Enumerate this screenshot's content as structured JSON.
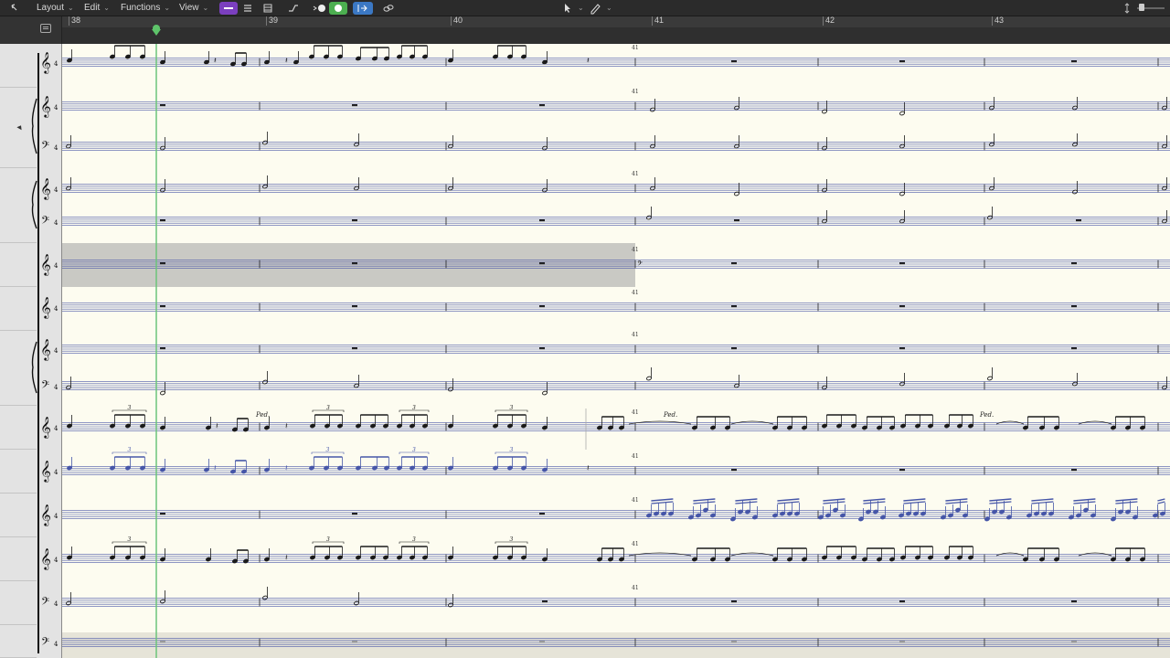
{
  "toolbar": {
    "back_icon": "back-arrow-icon",
    "menus": [
      {
        "label": "Layout"
      },
      {
        "label": "Edit"
      },
      {
        "label": "Functions"
      },
      {
        "label": "View"
      }
    ],
    "view_modes": [
      "linear-view-icon",
      "page-view-icon",
      "score-set-icon"
    ],
    "tools": [
      "catch-icon",
      "midi-in-icon",
      "midi-out-icon",
      "link-icon"
    ],
    "pointer_tool": "pointer-icon",
    "pencil_tool": "pencil-icon",
    "accent_purple": "#7b3fbf",
    "accent_green": "#4caf50",
    "accent_blue": "#3b78c4"
  },
  "ruler": {
    "bars": [
      "38",
      "39",
      "40",
      "41",
      "42",
      "43"
    ],
    "playhead_color": "#5ec46a"
  },
  "score": {
    "measure_label": "41",
    "pedal_label": "Ped.",
    "tuplet_label": "3",
    "note_black": "#1a1a1a",
    "note_blue": "#4656a8",
    "region_shade": "#c9c9c4",
    "clefs": [
      "treble",
      "treble",
      "bass",
      "treble",
      "bass",
      "treble",
      "treble",
      "treble",
      "bass",
      "treble",
      "treble",
      "treble",
      "treble",
      "bass",
      "bass"
    ]
  }
}
